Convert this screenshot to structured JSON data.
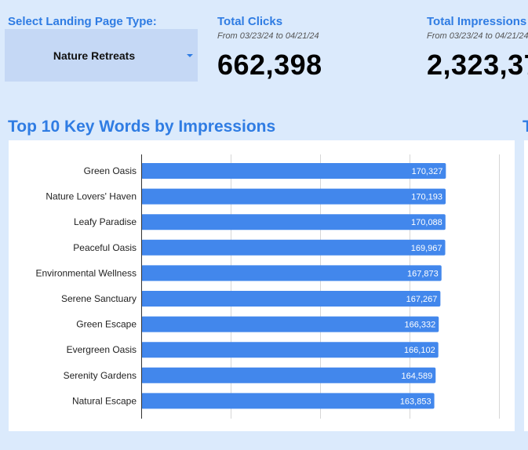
{
  "filter": {
    "label": "Select Landing Page Type:",
    "selected": "Nature Retreats"
  },
  "total_clicks": {
    "label": "Total Clicks",
    "date_range": "From 03/23/24 to 04/21/24",
    "value": "662,398"
  },
  "total_impressions": {
    "label": "Total Impressions",
    "date_range": "From 03/23/24 to 04/21/24",
    "value": "2,323,37"
  },
  "next_section_title": "T",
  "colors": {
    "background": "#dbeafc",
    "accent": "#2f7ce3",
    "bar": "#4287ec",
    "dropdown": "#c5d8f5"
  },
  "chart_data": {
    "type": "bar",
    "orientation": "horizontal",
    "title": "Top 10 Key Words by Impressions",
    "categories": [
      "Green Oasis",
      "Nature Lovers' Haven",
      "Leafy Paradise",
      "Peaceful Oasis",
      "Environmental Wellness",
      "Serene Sanctuary",
      "Green Escape",
      "Evergreen Oasis",
      "Serenity Gardens",
      "Natural Escape"
    ],
    "values": [
      170327,
      170193,
      170088,
      169967,
      167873,
      167267,
      166332,
      166102,
      164589,
      163853
    ],
    "value_labels": [
      "170,327",
      "170,193",
      "170,088",
      "169,967",
      "167,873",
      "167,267",
      "166,332",
      "166,102",
      "164,589",
      "163,853"
    ],
    "xlim": [
      0,
      200000
    ],
    "grid": true,
    "legend": "none"
  }
}
